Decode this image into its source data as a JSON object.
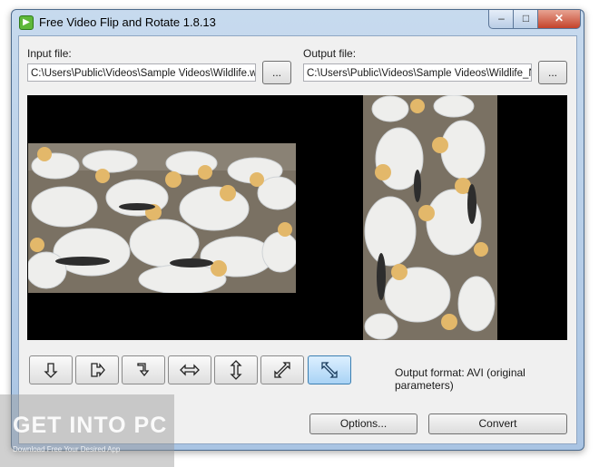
{
  "window": {
    "title": "Free Video Flip and Rotate 1.8.13",
    "app_icon": "film-icon",
    "controls": {
      "minimize": "–",
      "maximize": "□",
      "close": "✕"
    }
  },
  "input": {
    "label": "Input file:",
    "value": "C:\\Users\\Public\\Videos\\Sample Videos\\Wildlife.wmv",
    "browse_label": "..."
  },
  "output": {
    "label": "Output file:",
    "value": "C:\\Users\\Public\\Videos\\Sample Videos\\Wildlife_NEW.avi",
    "browse_label": "..."
  },
  "preview": {
    "input_frame": "gannets-colony-image",
    "output_frame": "gannets-colony-rotated-image"
  },
  "tools": [
    {
      "name": "rotate-left-icon",
      "active": false
    },
    {
      "name": "flip-rotate-icon",
      "active": false
    },
    {
      "name": "rotate-right-icon",
      "active": false
    },
    {
      "name": "flip-horizontal-icon",
      "active": false
    },
    {
      "name": "flip-vertical-icon",
      "active": false
    },
    {
      "name": "transpose-icon",
      "active": false
    },
    {
      "name": "transverse-icon",
      "active": true
    }
  ],
  "output_format": "Output format: AVI (original parameters)",
  "buttons": {
    "options": "Options...",
    "convert": "Convert"
  },
  "watermark": {
    "text": "GET INTO PC",
    "subtext": "Download Free Your Desired App"
  },
  "colors": {
    "accent": "#3c7fb1",
    "window_frame": "#a9c4e3",
    "close": "#c4432b"
  }
}
